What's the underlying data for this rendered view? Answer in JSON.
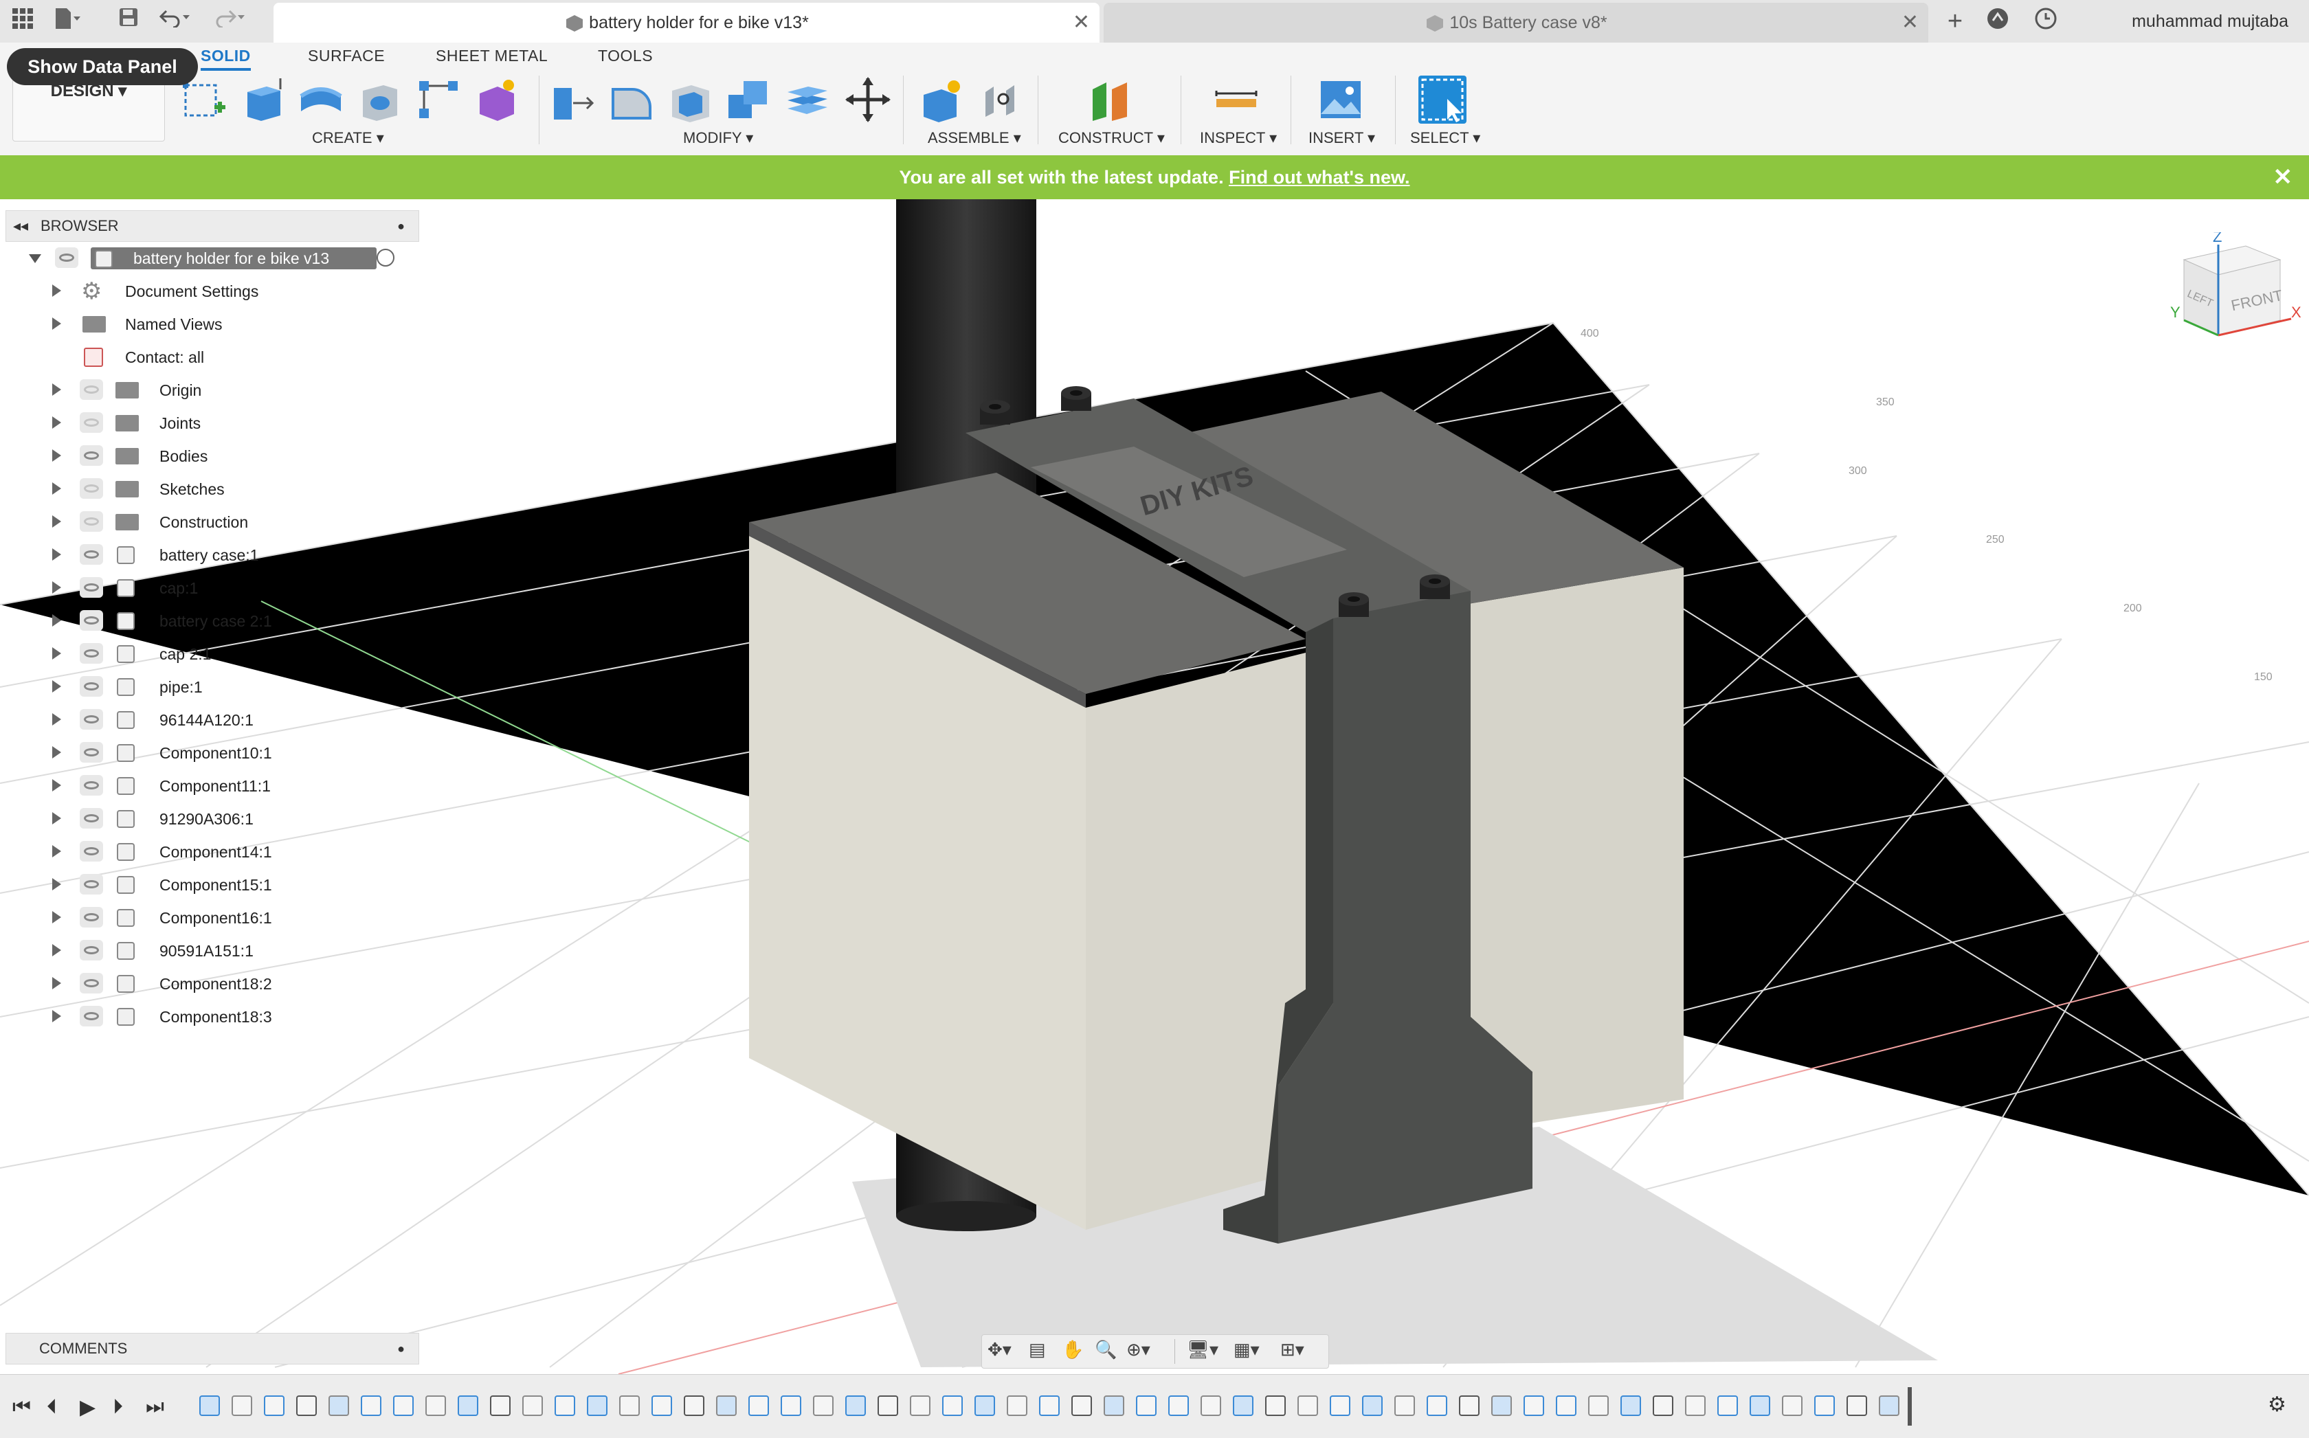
{
  "window": {
    "tabs": [
      {
        "label": "battery holder for e bike v13*",
        "active": true
      },
      {
        "label": "10s Battery case v8*",
        "active": false
      }
    ],
    "user": "muhammad mujtaba"
  },
  "tooltip": "Show Data Panel",
  "ribbon": {
    "workspace": "DESIGN",
    "tabs": [
      "SOLID",
      "SURFACE",
      "SHEET METAL",
      "TOOLS"
    ],
    "groups": [
      "CREATE",
      "MODIFY",
      "ASSEMBLE",
      "CONSTRUCT",
      "INSPECT",
      "INSERT",
      "SELECT"
    ]
  },
  "banner": {
    "text": "You are all set with the latest update.",
    "link": "Find out what's new."
  },
  "browser": {
    "title": "BROWSER",
    "root": "battery holder for e bike v13",
    "items": [
      {
        "label": "Document Settings",
        "icon": "gear-icon"
      },
      {
        "label": "Named Views",
        "icon": "folder-icon"
      },
      {
        "label": "Contact: all",
        "icon": "contact-icon"
      },
      {
        "label": "Origin",
        "icon": "folder-icon"
      },
      {
        "label": "Joints",
        "icon": "folder-icon"
      },
      {
        "label": "Bodies",
        "icon": "folder-icon"
      },
      {
        "label": "Sketches",
        "icon": "folder-icon"
      },
      {
        "label": "Construction",
        "icon": "folder-icon"
      },
      {
        "label": "battery case:1",
        "icon": "component-icon"
      },
      {
        "label": "cap:1",
        "icon": "component-icon"
      },
      {
        "label": "battery case 2:1",
        "icon": "component-icon"
      },
      {
        "label": "cap 2:1",
        "icon": "component-icon"
      },
      {
        "label": "pipe:1",
        "icon": "component-icon"
      },
      {
        "label": "96144A120:1",
        "icon": "component-icon"
      },
      {
        "label": "Component10:1",
        "icon": "component-icon"
      },
      {
        "label": "Component11:1",
        "icon": "component-icon"
      },
      {
        "label": "91290A306:1",
        "icon": "component-icon"
      },
      {
        "label": "Component14:1",
        "icon": "component-icon"
      },
      {
        "label": "Component15:1",
        "icon": "component-icon"
      },
      {
        "label": "Component16:1",
        "icon": "component-icon"
      },
      {
        "label": "90591A151:1",
        "icon": "component-icon"
      },
      {
        "label": "Component18:2",
        "icon": "component-icon"
      },
      {
        "label": "Component18:3",
        "icon": "component-icon"
      }
    ]
  },
  "comments": {
    "title": "COMMENTS"
  },
  "viewcube": {
    "face_front": "FRONT",
    "face_left": "LEFT",
    "axis_x": "X",
    "axis_y": "Y",
    "axis_z": "Z"
  },
  "grid_labels": [
    "400",
    "350",
    "300",
    "250",
    "200",
    "150"
  ],
  "model_text": "DIY KITS",
  "colors": {
    "banner": "#8dc63f",
    "accent": "#1f78c8",
    "case_top": "#6b6b69",
    "case_side": "#dcdad0",
    "bracket": "#4d4f4d",
    "pipe": "#2a2a2a"
  }
}
